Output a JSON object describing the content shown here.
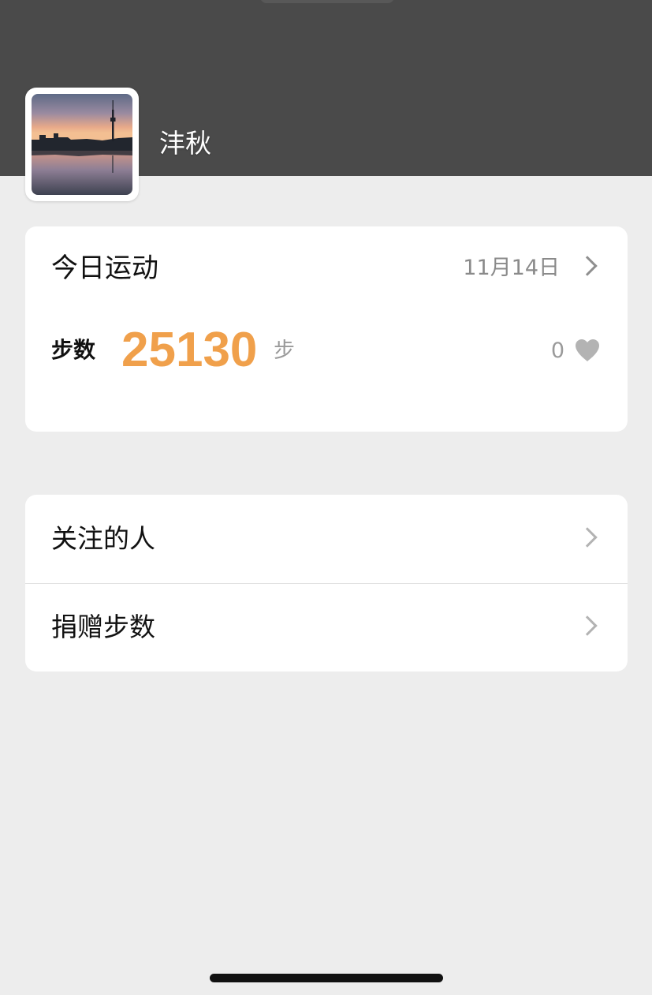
{
  "profile": {
    "username": "沣秋",
    "avatar_icon": "sunset-tower-photo"
  },
  "today": {
    "title": "今日运动",
    "date": "11月14日",
    "steps_label": "步数",
    "steps_value": "25130",
    "steps_unit": "步",
    "like_count": "0"
  },
  "menu": {
    "items": [
      {
        "label": "关注的人"
      },
      {
        "label": "捐赠步数"
      }
    ]
  },
  "colors": {
    "header_bg": "#4a4a4a",
    "page_bg": "#ededed",
    "accent_steps": "#f0a04b",
    "heart": "#b3b3b3"
  }
}
